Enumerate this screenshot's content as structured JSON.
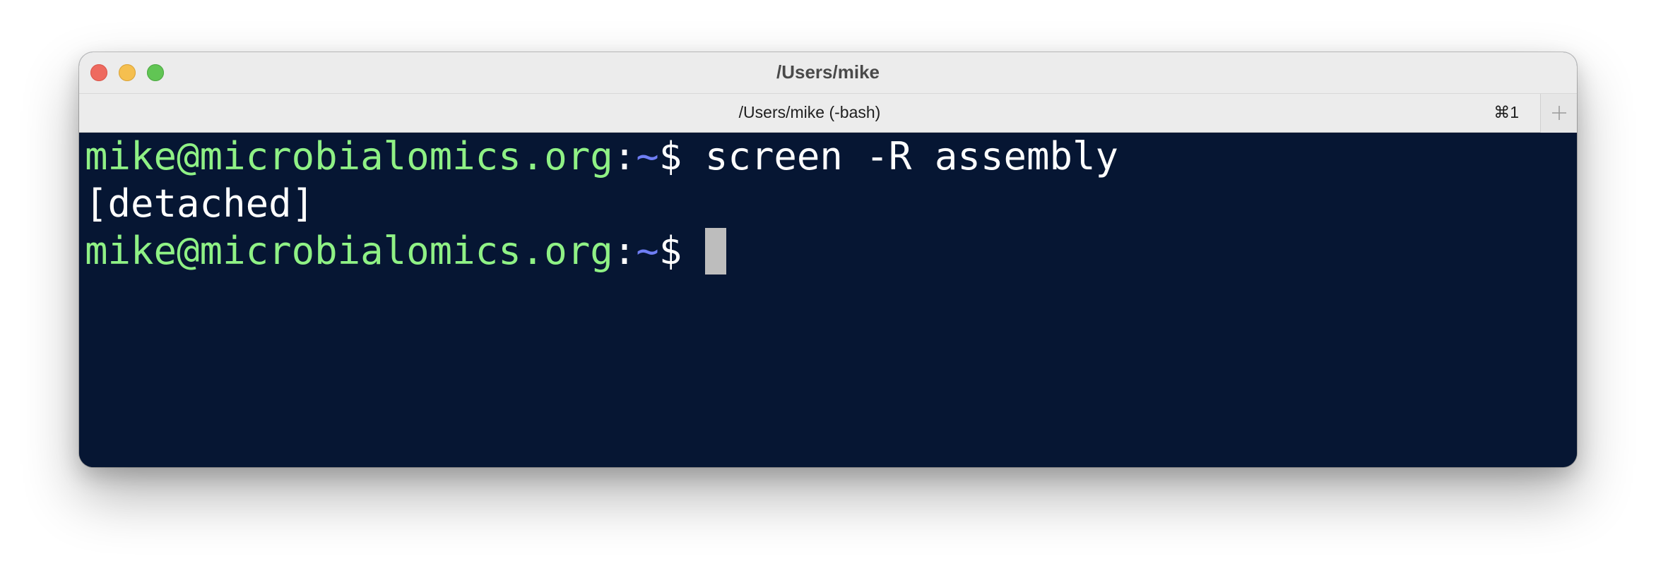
{
  "window": {
    "title": "/Users/mike"
  },
  "tab": {
    "label": "/Users/mike (-bash)",
    "shortcut": "⌘1"
  },
  "new_tab_icon": "plus-icon",
  "terminal": {
    "lines": [
      {
        "user_host": "mike@microbialomics.org",
        "separator": ":",
        "path": "~",
        "prompt": "$ ",
        "command": "screen -R assembly"
      },
      {
        "output": "[detached]"
      },
      {
        "user_host": "mike@microbialomics.org",
        "separator": ":",
        "path": "~",
        "prompt": "$ ",
        "command": ""
      }
    ]
  },
  "colors": {
    "terminal_background": "#061633",
    "user_host": "#8ff185",
    "path": "#6f7ef4",
    "text": "#ffffff",
    "cursor": "#bdbdbd",
    "close": "#ee6a5f",
    "minimize": "#f5bf4f",
    "maximize": "#61c554"
  }
}
